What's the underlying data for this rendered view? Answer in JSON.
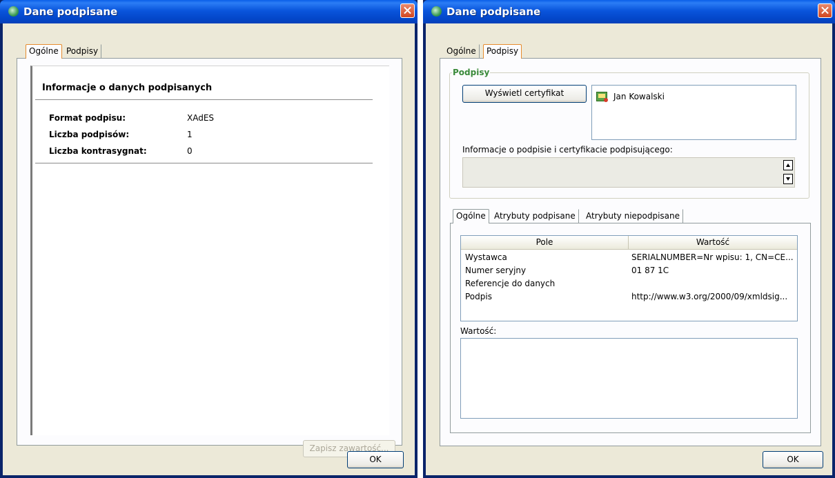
{
  "left_window": {
    "title": "Dane podpisane",
    "tabs": [
      {
        "label": "Ogólne",
        "active": true
      },
      {
        "label": "Podpisy",
        "active": false
      }
    ],
    "heading": "Informacje o danych podpisanych",
    "rows": [
      {
        "label": "Format podpisu:",
        "value": "XAdES"
      },
      {
        "label": "Liczba podpisów:",
        "value": "1"
      },
      {
        "label": "Liczba kontrasygnat:",
        "value": "0"
      }
    ],
    "save_button": "Zapisz zawartość...",
    "ok_button": "OK"
  },
  "right_window": {
    "title": "Dane podpisane",
    "tabs": [
      {
        "label": "Ogólne",
        "active": false
      },
      {
        "label": "Podpisy",
        "active": true
      }
    ],
    "group_label": "Podpisy",
    "show_cert_button": "Wyświetl certyfikat",
    "signers": [
      "Jan Kowalski"
    ],
    "info_label": "Informacje o podpisie i certyfikacie podpisującego:",
    "inner_tabs": [
      {
        "label": "Ogólne",
        "active": true
      },
      {
        "label": "Atrybuty podpisane",
        "active": false
      },
      {
        "label": "Atrybuty niepodpisane",
        "active": false
      }
    ],
    "table": {
      "columns": [
        "Pole",
        "Wartość"
      ],
      "rows": [
        [
          "Wystawca",
          "SERIALNUMBER=Nr wpisu: 1, CN=CE..."
        ],
        [
          "Numer seryjny",
          "01 87 1C"
        ],
        [
          "Referencje do danych",
          ""
        ],
        [
          "Podpis",
          "http://www.w3.org/2000/09/xmldsig..."
        ]
      ]
    },
    "value_label": "Wartość:",
    "ok_button": "OK"
  },
  "colors": {
    "titlebar": "#0a55dc",
    "dialog_bg": "#ece9d8",
    "active_tab_border": "#e68b2c",
    "group_label": "#3a8a3a"
  }
}
